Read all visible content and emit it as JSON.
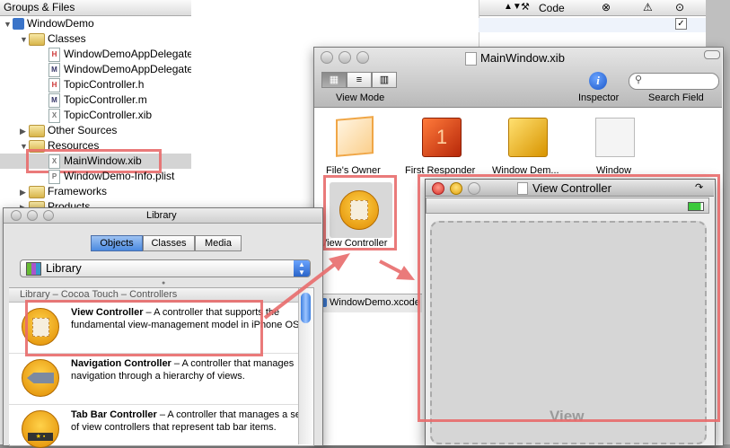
{
  "groups": {
    "header": "Groups & Files",
    "columns": [
      "Code"
    ],
    "items": [
      {
        "label": "WindowDemo"
      },
      {
        "label": "Classes"
      },
      {
        "label": "WindowDemoAppDelegate.h",
        "badge": "H"
      },
      {
        "label": "WindowDemoAppDelegate.m",
        "badge": "M"
      },
      {
        "label": "TopicController.h",
        "badge": "H"
      },
      {
        "label": "TopicController.m",
        "badge": "M"
      },
      {
        "label": "TopicController.xib",
        "badge": "X"
      },
      {
        "label": "Other Sources"
      },
      {
        "label": "Resources"
      },
      {
        "label": "MainWindow.xib",
        "badge": "X"
      },
      {
        "label": "WindowDemo-Info.plist",
        "badge": "P"
      },
      {
        "label": "Frameworks"
      },
      {
        "label": "Products"
      }
    ]
  },
  "xib": {
    "title": "MainWindow.xib",
    "view_mode": "View Mode",
    "inspector": "Inspector",
    "search_field": "Search Field",
    "objects": [
      {
        "label": "File's Owner"
      },
      {
        "label": "First Responder"
      },
      {
        "label": "Window Dem..."
      },
      {
        "label": "Window"
      },
      {
        "label": "View Controller"
      }
    ],
    "status": "WindowDemo.xcode"
  },
  "vc_window": {
    "title": "View Controller",
    "view_label": "View"
  },
  "library": {
    "title": "Library",
    "tabs": [
      "Objects",
      "Classes",
      "Media"
    ],
    "popup": "Library",
    "section": "Library – Cocoa Touch – Controllers",
    "items": [
      {
        "name": "View Controller",
        "desc": " – A controller that supports the fundamental view-management model in iPhone OS."
      },
      {
        "name": "Navigation Controller",
        "desc": " – A controller that manages navigation through a hierarchy of views."
      },
      {
        "name": "Tab Bar Controller",
        "desc": " – A controller that manages a set of view controllers that represent tab bar items."
      }
    ]
  }
}
